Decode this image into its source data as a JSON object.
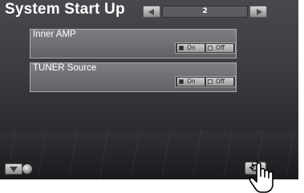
{
  "header": {
    "title": "System Start Up"
  },
  "page_nav": {
    "page_number": "2",
    "prev_icon": "left-arrow-icon",
    "next_icon": "right-arrow-icon"
  },
  "settings": [
    {
      "label": "Inner AMP",
      "on_label": "On",
      "off_label": "Off",
      "selected": "On"
    },
    {
      "label": "TUNER Source",
      "on_label": "On",
      "off_label": "Off",
      "selected": "On"
    }
  ],
  "footer": {
    "down_icon": "down-arrow-icon",
    "return_icon": "return-icon",
    "pointer_icon": "hand-pointer-icon"
  }
}
